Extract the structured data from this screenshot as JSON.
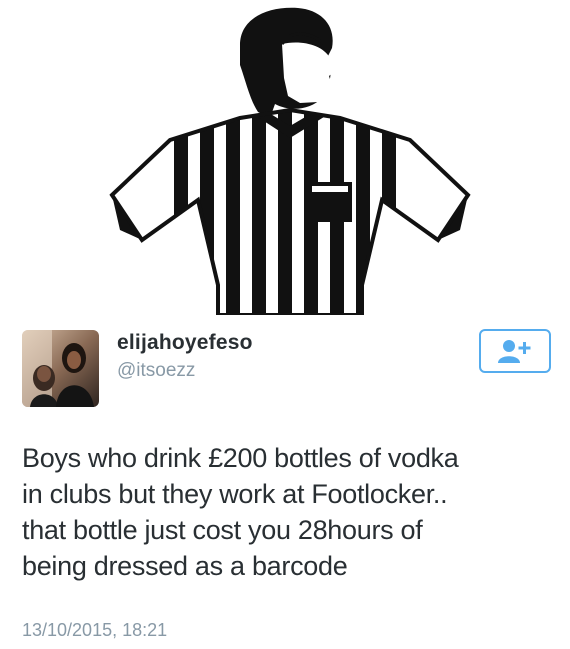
{
  "tweet": {
    "display_name": "elijahoyefeso",
    "handle": "@itsoezz",
    "text_lines": [
      "Boys who drink £200 bottles of vodka",
      "in clubs but they work at Footlocker..",
      "that bottle just cost you 28hours of",
      "being dressed as a barcode"
    ],
    "timestamp": "13/10/2015, 18:21"
  },
  "icons": {
    "logo": "referee-logo",
    "follow": "follow-user-icon"
  },
  "colors": {
    "text": "#292f33",
    "muted": "#8899a6",
    "accent": "#55acee"
  }
}
